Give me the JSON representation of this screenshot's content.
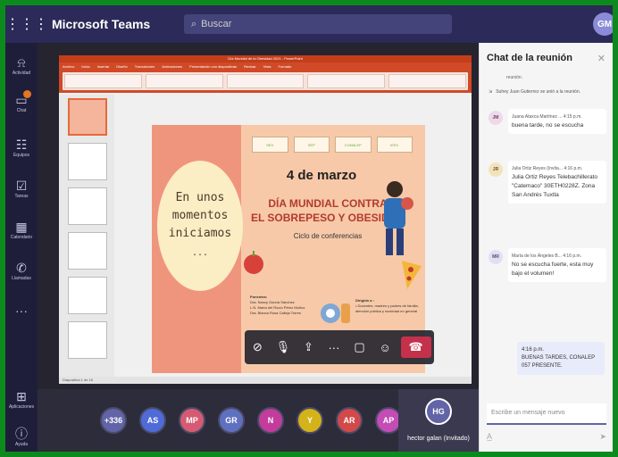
{
  "app": {
    "title": "Microsoft Teams",
    "search_placeholder": "Buscar",
    "user_initials": "GM"
  },
  "rail": [
    {
      "icon": "activity-icon",
      "glyph": "⍾",
      "label": "Actividad"
    },
    {
      "icon": "chat-icon",
      "glyph": "▭",
      "label": "Chat"
    },
    {
      "icon": "teams-icon",
      "glyph": "☷",
      "label": "Equipos"
    },
    {
      "icon": "tasks-icon",
      "glyph": "☑",
      "label": "Tareas"
    },
    {
      "icon": "calendar-icon",
      "glyph": "▦",
      "label": "Calendario"
    },
    {
      "icon": "calls-icon",
      "glyph": "✆",
      "label": "Llamadas"
    },
    {
      "icon": "more-icon",
      "glyph": "···",
      "label": ""
    },
    {
      "icon": "apps-icon",
      "glyph": "⊞",
      "label": "Aplicaciones"
    },
    {
      "icon": "help-icon",
      "glyph": "ⓘ",
      "label": "Ayuda"
    }
  ],
  "powerpoint": {
    "window_title": "Día Mundial de la Obesidad 2021 - PowerPoint",
    "tabs": [
      "Archivo",
      "Inicio",
      "Insertar",
      "Diseño",
      "Transiciones",
      "Animaciones",
      "Presentación con diapositivas",
      "Revisar",
      "Vista",
      "Formato"
    ],
    "status": "Diapositiva 1 de 16"
  },
  "slide": {
    "circle_text": [
      "En unos",
      "momentos",
      "iniciamos"
    ],
    "circle_dots": "...",
    "date": "4 de marzo",
    "heading": [
      "DÍA MUNDIAL CONTRA",
      "EL SOBREPESO Y OBESIDAD"
    ],
    "subtitle": "Ciclo de conferencias",
    "presenters_title": "Ponentes:",
    "presenters": [
      "Dra. Nancy García Sánchez",
      "L.N. María del Rocío Pérez Muñoz",
      "Dra. Blanca Rosa Calleja Torres"
    ],
    "directed_title": "Dirigido a :",
    "directed": [
      "• Docentes, madres y padres de familia, atención pública y sociedad en general"
    ],
    "logos": [
      "SEV",
      "SEP",
      "CONALEP",
      "IEEV"
    ]
  },
  "participants": [
    {
      "initials": "+336",
      "color": "#6264a7"
    },
    {
      "initials": "AS",
      "color": "#4f6bd8"
    },
    {
      "initials": "MP",
      "color": "#d65b72"
    },
    {
      "initials": "GR",
      "color": "#6070c0"
    },
    {
      "initials": "N",
      "color": "#c33c9b"
    },
    {
      "initials": "Y",
      "color": "#d4b21a"
    },
    {
      "initials": "AR",
      "color": "#d14949"
    },
    {
      "initials": "AP",
      "color": "#c34cb5"
    }
  ],
  "presenter": {
    "initials": "HG",
    "name": "hector galan (Invitado)"
  },
  "chat": {
    "title": "Chat de la reunión",
    "system_note": "reunión.",
    "join_note": "Suhey Juan Gutierrez se unió a la reunión.",
    "messages": [
      {
        "initials": "JM",
        "name": "Juana Ataxca Martínez ...",
        "time": "4:15 p.m.",
        "text": "buena tarde, no se escucha",
        "color": "#f0d8ea"
      },
      {
        "initials": "JR",
        "name": "Julia Ortiz Reyes (Invita...",
        "time": "4:16 p.m.",
        "text": "Julia Ortiz Reyes Telebachillerato \"Catemaco\" 30ETH0228Z. Zona San Andrés Tuxtla",
        "color": "#f5e3b8"
      },
      {
        "initials": "MR",
        "name": "María de los Ángeles B...",
        "time": "4:16 p.m.",
        "text": "No se escucha fuerte, esta muy bajo el volumen!",
        "color": "#dfe0f5"
      }
    ],
    "self_time": "4:16 p.m.",
    "self_text": "BUENAS TARDES, CONALEP 057 PRESENTE.",
    "input_placeholder": "Escribe un mensaje nuevo"
  }
}
